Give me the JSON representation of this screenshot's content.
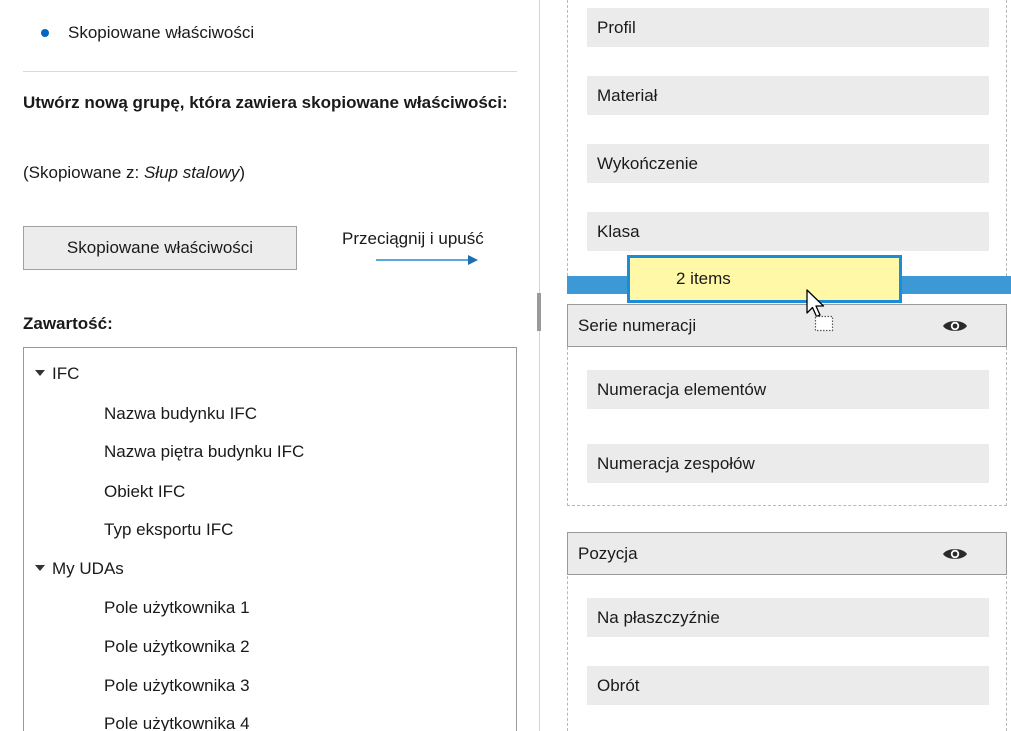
{
  "left": {
    "radio_label": "Skopiowane właściwości",
    "desc_text": "Utwórz nową grupę, która zawiera skopiowane właściwości:",
    "copied_prefix": "(Skopiowane z: ",
    "copied_source": "Słup stalowy",
    "copied_suffix": ")",
    "copy_button_label": "Skopiowane właściwości",
    "drag_hint": "Przeciągnij i upuść",
    "contents_label": "Zawartość:",
    "tree": {
      "group1": {
        "label": "IFC",
        "items": [
          "Nazwa budynku IFC",
          "Nazwa piętra budynku IFC",
          "Obiekt IFC",
          "Typ eksportu IFC"
        ]
      },
      "group2": {
        "label": "My UDAs",
        "items": [
          "Pole użytkownika 1",
          "Pole użytkownika 2",
          "Pole użytkownika 3",
          "Pole użytkownika 4"
        ]
      }
    }
  },
  "right": {
    "props_top": [
      "Profil",
      "Materiał",
      "Wykończenie",
      "Klasa"
    ],
    "drag_tooltip": "2 items",
    "group_numbering": {
      "title": "Serie numeracji",
      "items": [
        "Numeracja elementów",
        "Numeracja zespołów"
      ]
    },
    "group_position": {
      "title": "Pozycja",
      "items": [
        "Na płaszczyźnie",
        "Obrót"
      ]
    }
  },
  "colors": {
    "accent": "#0067c0",
    "drop_indicator": "#3d99d6",
    "tooltip_bg": "#fff8a6",
    "row_bg": "#ebebeb"
  },
  "icons": {
    "radio": "radio-selected-icon",
    "caret": "caret-down-icon",
    "arrow": "arrow-right-icon",
    "visibility": "eye-icon",
    "cursor": "drag-copy-cursor-icon"
  }
}
